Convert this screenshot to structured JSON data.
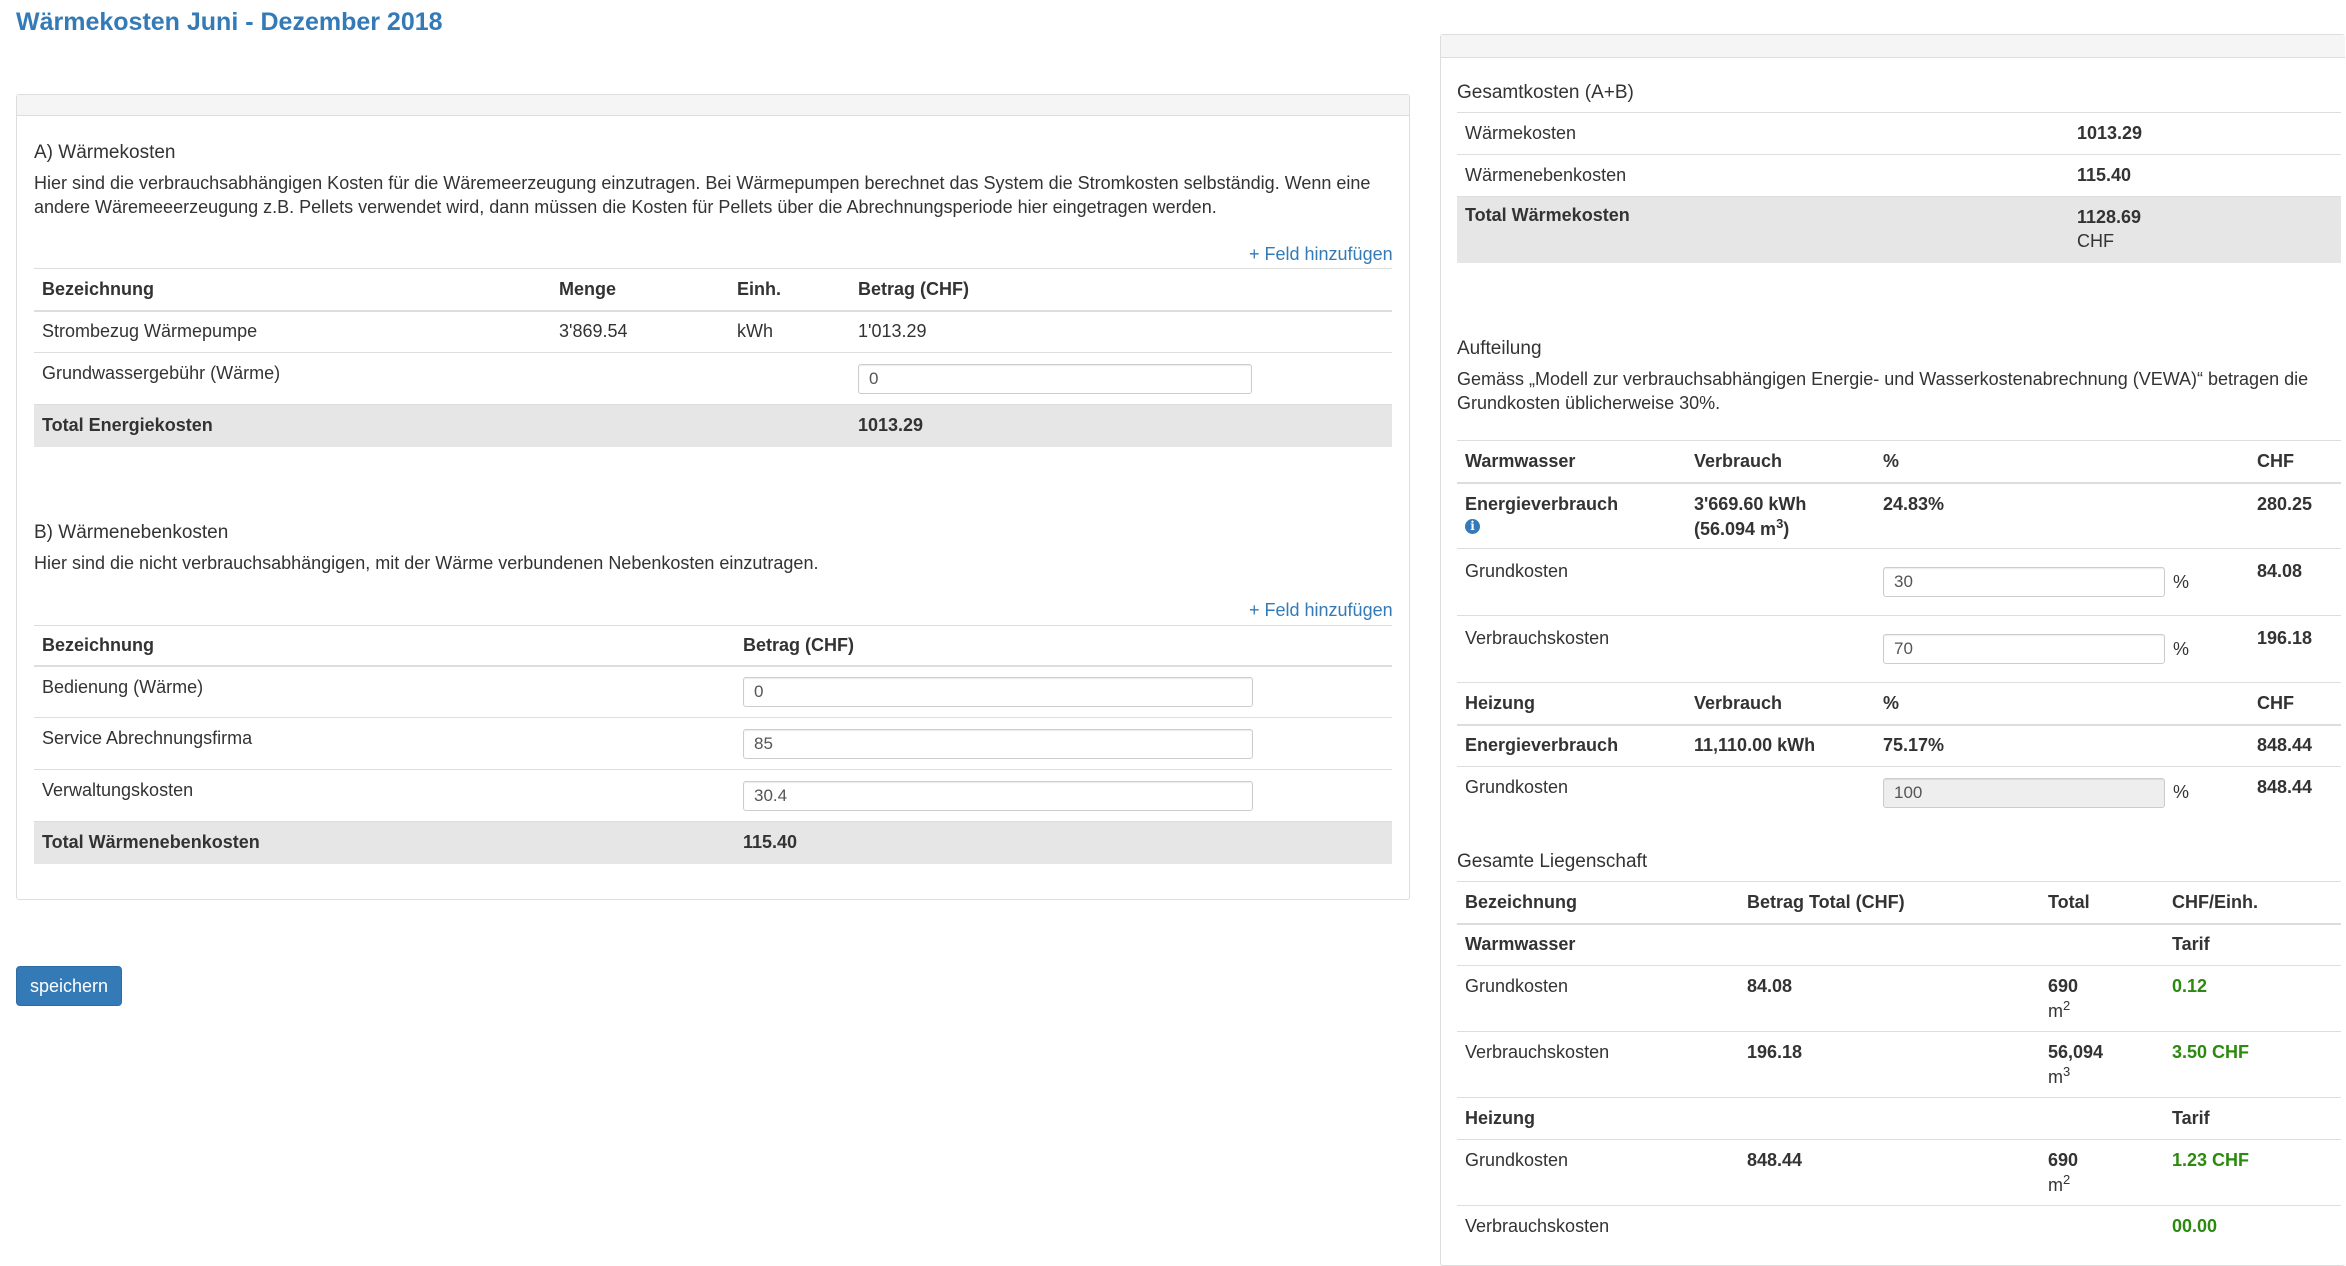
{
  "page": {
    "title": "Wärmekosten Juni - Dezember 2018"
  },
  "section_a": {
    "title": "A) Wärmekosten",
    "description": "Hier sind die verbrauchsabhängigen Kosten für die Wäremeerzeugung einzutragen. Bei Wärmepumpen berechnet das System die Stromkosten selbständig. Wenn eine andere Wäremeeerzeugung z.B. Pellets verwendet wird, dann müssen die Kosten für Pellets über die Abrechnungsperiode hier eingetragen werden.",
    "add_link": "+ Feld hinzufügen",
    "headers": [
      "Bezeichnung",
      "Menge",
      "Einh.",
      "Betrag (CHF)"
    ],
    "row1": {
      "label": "Strombezug Wärmepumpe",
      "menge": "3'869.54",
      "einheit": "kWh",
      "betrag": "1'013.29"
    },
    "row2": {
      "label": "Grundwassergebühr (Wärme)",
      "value": "0"
    },
    "total": {
      "label": "Total Energiekosten",
      "value": "1013.29"
    }
  },
  "section_b": {
    "title": "B) Wärmenebenkosten",
    "description": "Hier sind die nicht verbrauchsabhängigen, mit der Wärme verbundenen Nebenkosten einzutragen.",
    "add_link": "+ Feld hinzufügen",
    "headers": [
      "Bezeichnung",
      "Betrag (CHF)"
    ],
    "rows": [
      {
        "label": "Bedienung (Wärme)",
        "value": "0"
      },
      {
        "label": "Service Abrechnungsfirma",
        "value": "85"
      },
      {
        "label": "Verwaltungskosten",
        "value": "30.4"
      }
    ],
    "total": {
      "label": "Total Wärmenebenkosten",
      "value": "115.40"
    }
  },
  "save_button": "speichern",
  "gesamt": {
    "title": "Gesamtkosten (A+B)",
    "rows": [
      {
        "label": "Wärmekosten",
        "value": "1013.29"
      },
      {
        "label": "Wärmenebenkosten",
        "value": "115.40"
      }
    ],
    "total": {
      "label": "Total Wärmekosten",
      "value": "1128.69",
      "unit": "CHF"
    }
  },
  "aufteilung": {
    "title": "Aufteilung",
    "description": "Gemäss „Modell zur verbrauchsabhängigen Energie- und Wasserkostenabrechnung (VEWA)“ betragen die Grundkosten üblicherweise 30%.",
    "warmwasser": {
      "headers": [
        "Warmwasser",
        "Verbrauch",
        "%",
        "CHF"
      ],
      "energie": {
        "label": "Energieverbrauch",
        "verbrauch": "3'669.60 kWh",
        "verbrauch2": "(56.094 m",
        "sup": "3",
        "close": ")",
        "pct": "24.83%",
        "chf": "280.25"
      },
      "grund": {
        "label": "Grundkosten",
        "value": "30",
        "unit": "%",
        "chf": "84.08"
      },
      "verbrauch": {
        "label": "Verbrauchskosten",
        "value": "70",
        "unit": "%",
        "chf": "196.18"
      }
    },
    "heizung": {
      "headers": [
        "Heizung",
        "Verbrauch",
        "%",
        "CHF"
      ],
      "energie": {
        "label": "Energieverbrauch",
        "verbrauch": "11,110.00 kWh",
        "pct": "75.17%",
        "chf": "848.44"
      },
      "grund": {
        "label": "Grundkosten",
        "value": "100",
        "unit": "%",
        "chf": "848.44"
      }
    }
  },
  "liegenschaft": {
    "title": "Gesamte Liegenschaft",
    "headers": [
      "Bezeichnung",
      "Betrag Total (CHF)",
      "Total",
      "CHF/Einh."
    ],
    "warmwasser": {
      "label": "Warmwasser",
      "tarif": "Tarif",
      "grund": {
        "label": "Grundkosten",
        "betrag": "84.08",
        "total": "690",
        "unit": "m",
        "sup": "2",
        "rate": "0.12"
      },
      "verbrauch": {
        "label": "Verbrauchskosten",
        "betrag": "196.18",
        "total": "56,094",
        "unit": "m",
        "sup": "3",
        "rate": "3.50 CHF"
      }
    },
    "heizung": {
      "label": "Heizung",
      "tarif": "Tarif",
      "grund": {
        "label": "Grundkosten",
        "betrag": "848.44",
        "total": "690",
        "unit": "m",
        "sup": "2",
        "rate": "1.23 CHF"
      },
      "verbrauch": {
        "label": "Verbrauchskosten",
        "rate": "00.00"
      }
    }
  }
}
